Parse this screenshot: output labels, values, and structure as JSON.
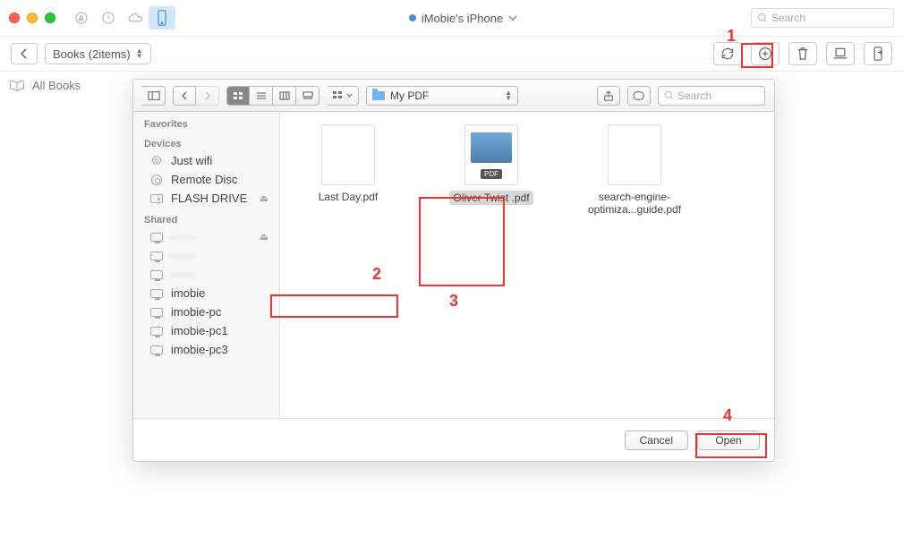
{
  "titlebar": {
    "device_name": "iMobie's iPhone",
    "search_placeholder": "Search"
  },
  "toolbar": {
    "breadcrumb": "Books (2items)"
  },
  "main_sidebar": {
    "all_books": "All Books"
  },
  "dialog": {
    "path_label": "My PDF",
    "search_placeholder": "Search",
    "sections": {
      "favorites": "Favorites",
      "devices": "Devices",
      "shared": "Shared"
    },
    "devices": [
      {
        "label": "Just wifi",
        "kind": "wifi"
      },
      {
        "label": "Remote Disc",
        "kind": "disc"
      },
      {
        "label": "FLASH DRIVE",
        "kind": "drive",
        "ejectable": true
      }
    ],
    "shared": [
      {
        "label": "——",
        "kind": "monitor",
        "blurred": true,
        "ejectable": true
      },
      {
        "label": "——",
        "kind": "monitor",
        "blurred": true
      },
      {
        "label": "——",
        "kind": "monitor",
        "blurred": true
      },
      {
        "label": "imobie",
        "kind": "monitor"
      },
      {
        "label": "imobie-pc",
        "kind": "monitor"
      },
      {
        "label": "imobie-pc1",
        "kind": "monitor"
      },
      {
        "label": "imobie-pc3",
        "kind": "monitor"
      }
    ],
    "files": [
      {
        "name": "Last Day.pdf",
        "thumb": "dark"
      },
      {
        "name": "Oliver Twist .pdf",
        "thumb": "pdf",
        "selected": true
      },
      {
        "name": "search-engine-optimiza...guide.pdf",
        "thumb": "lines"
      }
    ],
    "cancel": "Cancel",
    "open": "Open"
  },
  "annotations": {
    "a1": "1",
    "a2": "2",
    "a3": "3",
    "a4": "4"
  }
}
